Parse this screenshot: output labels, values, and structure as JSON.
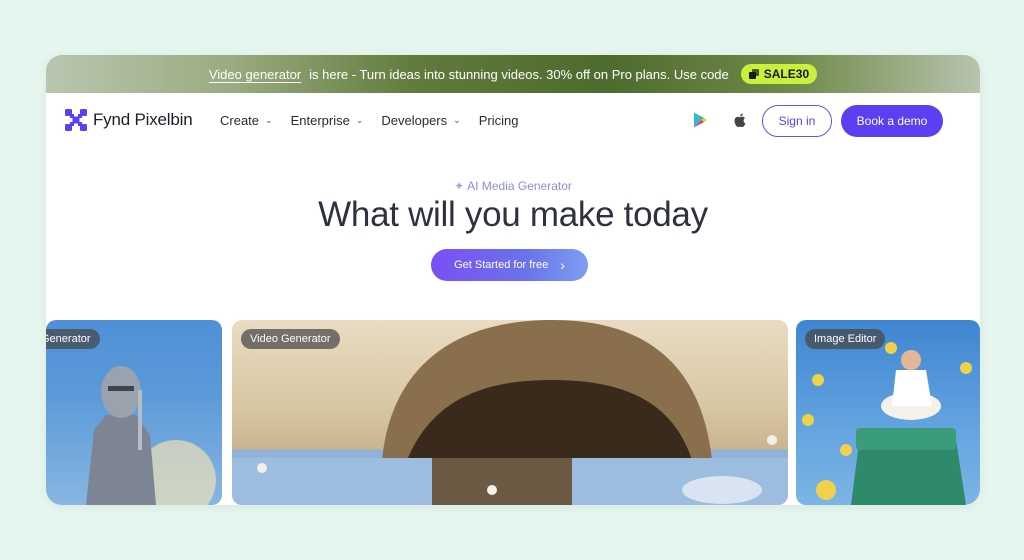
{
  "banner": {
    "link_text": "Video generator",
    "message": "is here - Turn ideas into stunning videos. 30% off on Pro plans. Use code",
    "code": "SALE30"
  },
  "brand": {
    "name": "Fynd Pixelbin"
  },
  "nav": {
    "items": [
      {
        "label": "Create",
        "has_dropdown": true
      },
      {
        "label": "Enterprise",
        "has_dropdown": true
      },
      {
        "label": "Developers",
        "has_dropdown": true
      },
      {
        "label": "Pricing",
        "has_dropdown": false
      }
    ],
    "icons": [
      "google-play-icon",
      "apple-icon"
    ],
    "sign_in": "Sign in",
    "book_demo": "Book a demo"
  },
  "hero": {
    "eyebrow": "AI Media Generator",
    "title": "What will you make today",
    "cta": "Get Started for free"
  },
  "cards": [
    {
      "label": "Generator"
    },
    {
      "label": "Video Generator"
    },
    {
      "label": "Image Editor"
    }
  ],
  "colors": {
    "accent": "#5b3ff2",
    "code_badge": "#c8f03c",
    "page_bg": "#e5f6ee"
  }
}
